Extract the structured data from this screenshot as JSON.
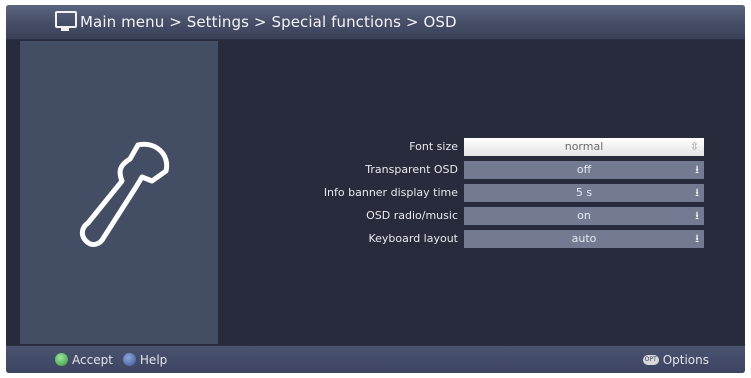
{
  "header": {
    "breadcrumb": "Main menu > Settings > Special functions > OSD",
    "icon": "tv-icon"
  },
  "settings": [
    {
      "label": "Font size",
      "value": "normal",
      "arrow": "⇳",
      "selected": true
    },
    {
      "label": "Transparent OSD",
      "value": "off",
      "arrow": "⭳",
      "selected": false
    },
    {
      "label": "Info banner display time",
      "value": "5 s",
      "arrow": "⭳",
      "selected": false
    },
    {
      "label": "OSD radio/music",
      "value": "on",
      "arrow": "⭳",
      "selected": false
    },
    {
      "label": "Keyboard layout",
      "value": "auto",
      "arrow": "⭳",
      "selected": false
    }
  ],
  "footer": {
    "accept_label": "Accept",
    "help_label": "Help",
    "options_key": "OPT",
    "options_label": "Options"
  },
  "colors": {
    "background": "#272b3c",
    "side_panel": "#434d63",
    "accept_key": "#3aa53f",
    "help_key": "#3a559f"
  }
}
